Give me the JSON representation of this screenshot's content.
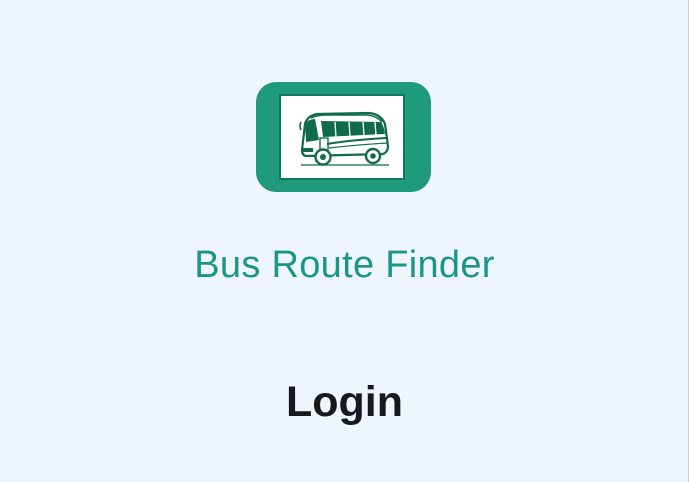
{
  "app": {
    "title": "Bus Route Finder",
    "logo_icon": "bus-icon"
  },
  "login": {
    "heading": "Login"
  },
  "colors": {
    "background": "#eef5fc",
    "accent": "#1f9b7c",
    "title_text": "#1a9687",
    "heading_text": "#16191d"
  }
}
